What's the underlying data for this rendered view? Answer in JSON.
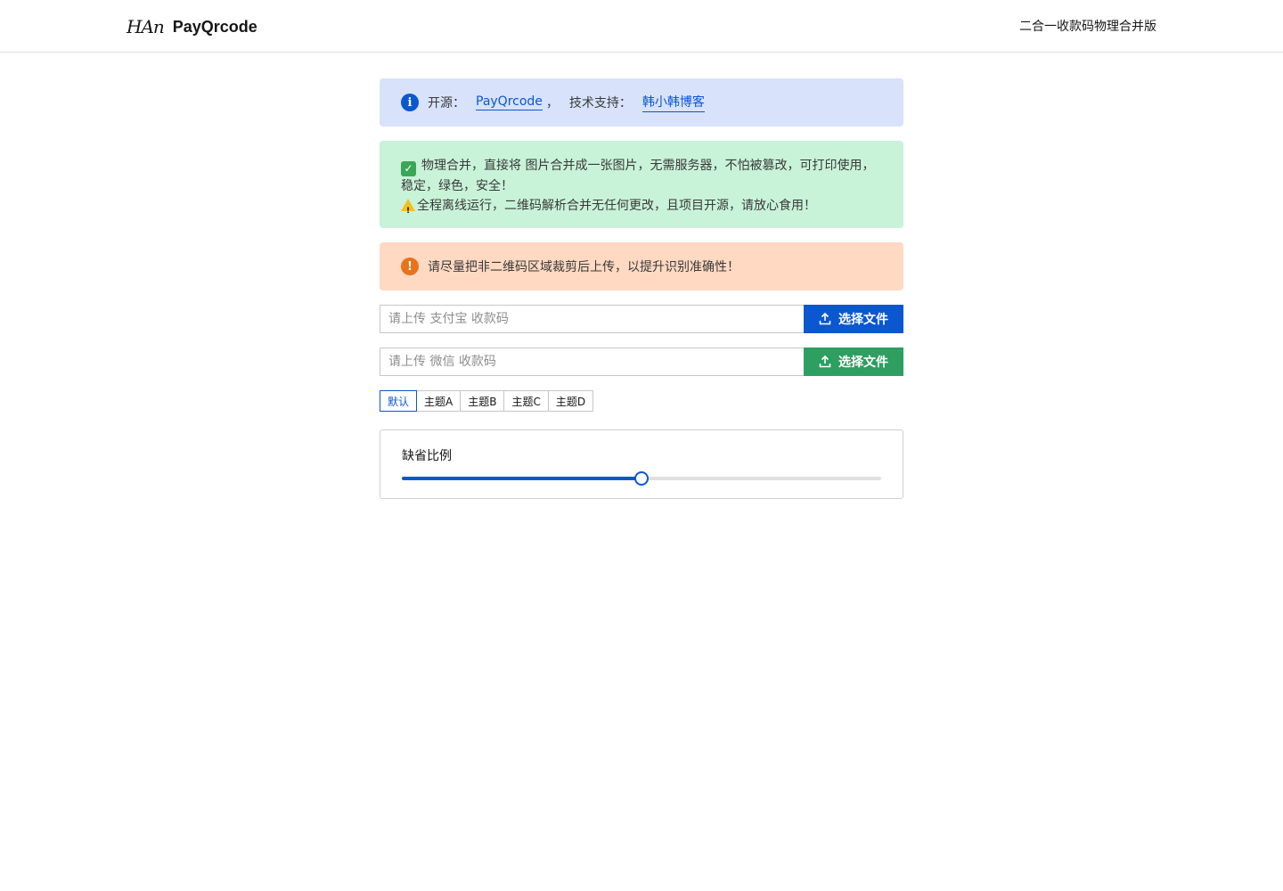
{
  "header": {
    "logo_mark": "HAn",
    "brand": "PayQrcode",
    "right_text": "二合一收款码物理合并版"
  },
  "notices": {
    "info": {
      "prefix": "开源：",
      "repo_link": "PayQrcode",
      "separator": "，",
      "support_label": "技术支持：",
      "support_link": "韩小韩博客"
    },
    "success": {
      "line1": "物理合并，直接将 图片合并成一张图片，无需服务器，不怕被篡改，可打印使用，",
      "line2": "稳定，绿色，安全！",
      "line3": "全程离线运行，二维码解析合并无任何更改，且项目开源，请放心食用！"
    },
    "warning": {
      "text": "请尽量把非二维码区域裁剪后上传，以提升识别准确性！"
    }
  },
  "uploads": {
    "alipay": {
      "placeholder": "请上传 支付宝 收款码",
      "button": "选择文件",
      "color": "#0b57d0"
    },
    "wechat": {
      "placeholder": "请上传 微信 收款码",
      "button": "选择文件",
      "color": "#2e9e61"
    }
  },
  "themes": {
    "items": [
      "默认",
      "主题A",
      "主题B",
      "主题C",
      "主题D"
    ],
    "selected": "默认"
  },
  "scale": {
    "label": "缺省比例",
    "value_fraction": 0.5
  }
}
